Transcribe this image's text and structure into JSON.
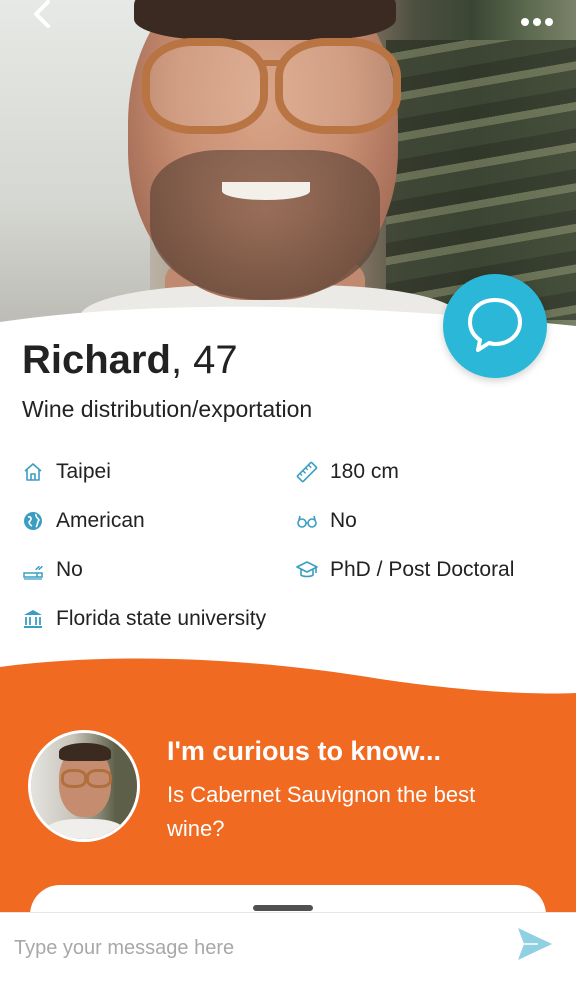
{
  "profile": {
    "name": "Richard",
    "age_text": ", 47",
    "occupation": "Wine distribution/exportation"
  },
  "attributes": {
    "location": "Taipei",
    "height": "180 cm",
    "nationality": "American",
    "glasses": "No",
    "smoking": "No",
    "education_level": "PhD / Post Doctoral",
    "school": "Florida state university"
  },
  "question": {
    "title": "I'm curious to know...",
    "text": "Is Cabernet Sauvignon the best wine?"
  },
  "message": {
    "placeholder": "Type your message here"
  },
  "icons": {
    "back": "chevron-left-icon",
    "more": "more-horizontal-icon",
    "chat": "chat-bubble-icon",
    "send": "send-icon"
  },
  "colors": {
    "accent_blue": "#2bb8d8",
    "orange": "#f06a21",
    "icon_teal": "#3a9ec2"
  }
}
